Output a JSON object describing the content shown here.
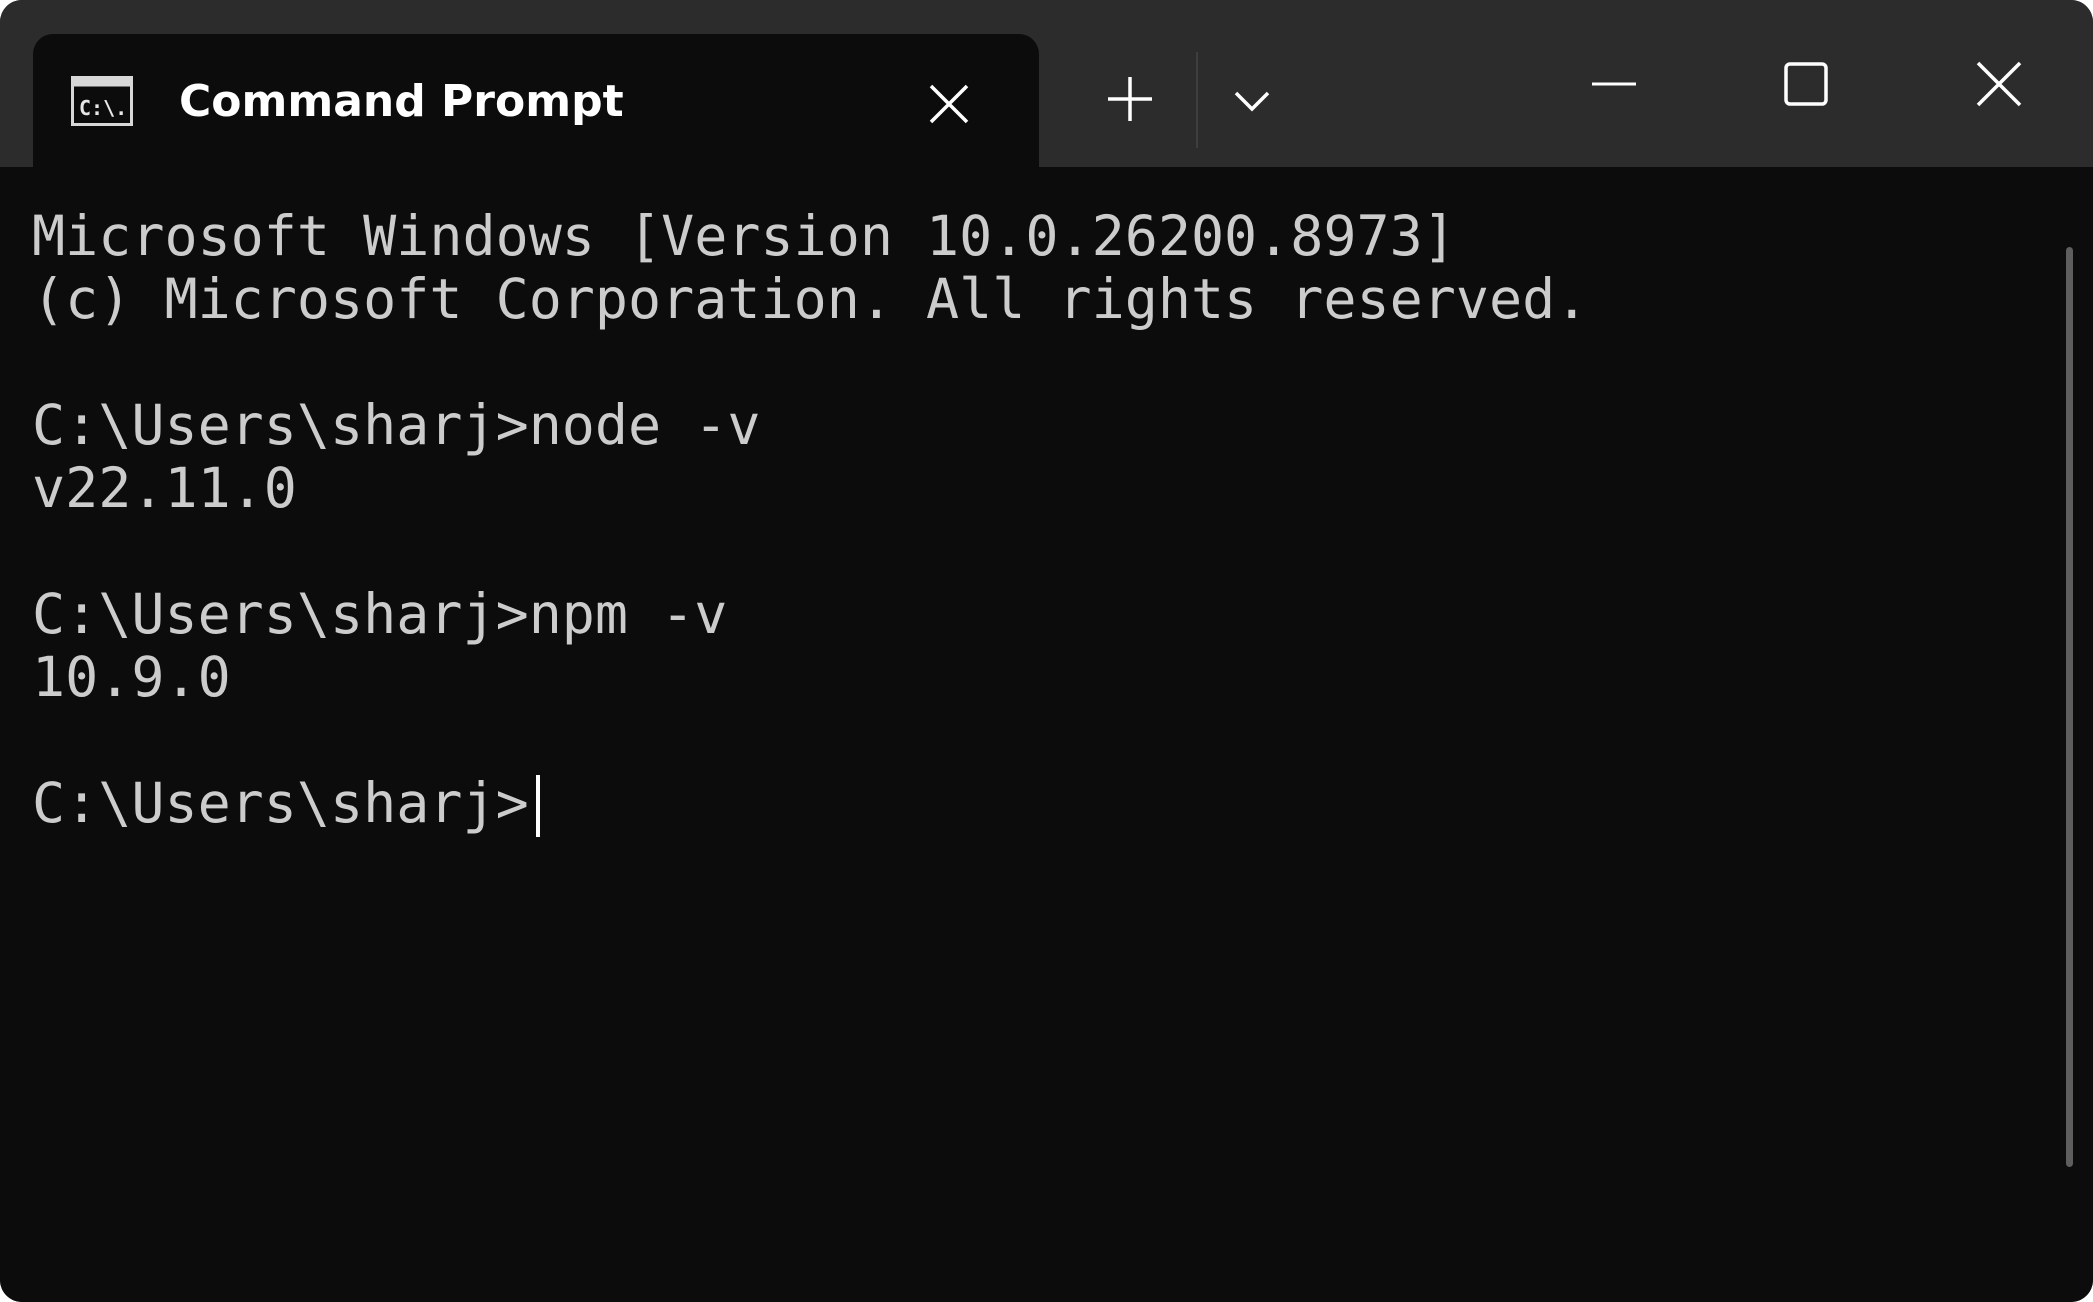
{
  "tab": {
    "title": "Command Prompt",
    "icon": "cmd-icon",
    "icon_text": "C:\\."
  },
  "toolbar": {
    "new_tab_icon": "plus-icon",
    "dropdown_icon": "chevron-down-icon"
  },
  "caption_buttons": {
    "minimize_icon": "minimize-icon",
    "maximize_icon": "maximize-icon",
    "close_icon": "close-icon"
  },
  "terminal": {
    "lines": [
      "Microsoft Windows [Version 10.0.26200.8973]",
      "(c) Microsoft Corporation. All rights reserved.",
      "",
      "C:\\Users\\sharj>node -v",
      "v22.11.0",
      "",
      "C:\\Users\\sharj>npm -v",
      "10.9.0",
      "",
      "C:\\Users\\sharj>"
    ]
  },
  "colors": {
    "background": "#0c0c0c",
    "titlebar": "#2c2c2c",
    "text": "#cccccc"
  }
}
